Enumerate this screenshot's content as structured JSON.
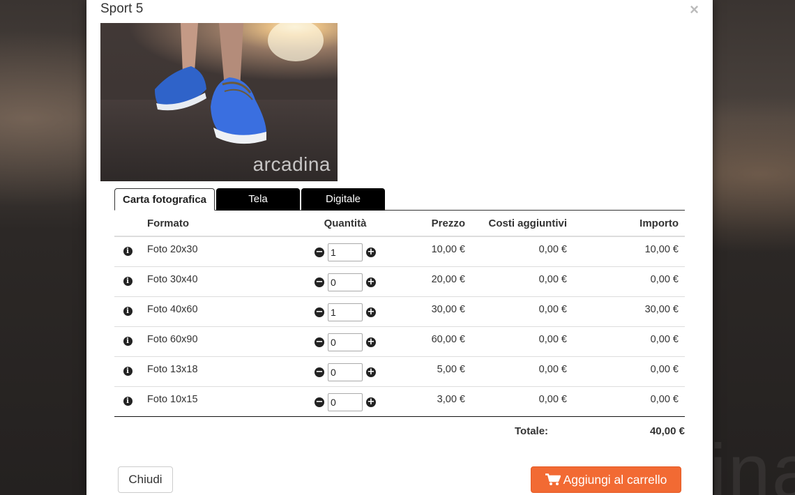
{
  "modal": {
    "title": "Sport 5",
    "close_glyph": "×",
    "photo_watermark": "arcadina"
  },
  "tabs": [
    {
      "label": "Carta fotografica",
      "active": true
    },
    {
      "label": "Tela",
      "active": false
    },
    {
      "label": "Digitale",
      "active": false
    }
  ],
  "table": {
    "headers": {
      "format": "Formato",
      "quantity": "Quantità",
      "price": "Prezzo",
      "extra": "Costi aggiuntivi",
      "amount": "Importo"
    },
    "rows": [
      {
        "format": "Foto 20x30",
        "quantity": "1",
        "price": "10,00 €",
        "extra": "0,00 €",
        "amount": "10,00 €"
      },
      {
        "format": "Foto 30x40",
        "quantity": "0",
        "price": "20,00 €",
        "extra": "0,00 €",
        "amount": "0,00 €"
      },
      {
        "format": "Foto 40x60",
        "quantity": "1",
        "price": "30,00 €",
        "extra": "0,00 €",
        "amount": "30,00 €"
      },
      {
        "format": "Foto 60x90",
        "quantity": "0",
        "price": "60,00 €",
        "extra": "0,00 €",
        "amount": "0,00 €"
      },
      {
        "format": "Foto 13x18",
        "quantity": "0",
        "price": "5,00 €",
        "extra": "0,00 €",
        "amount": "0,00 €"
      },
      {
        "format": "Foto 10x15",
        "quantity": "0",
        "price": "3,00 €",
        "extra": "0,00 €",
        "amount": "0,00 €"
      }
    ]
  },
  "total": {
    "label": "Totale:",
    "value": "40,00 €"
  },
  "buttons": {
    "close_label": "Chiudi",
    "cart_label": "Aggiungi al carrello",
    "cart_icon": "shopping-cart-icon"
  },
  "colors": {
    "accent": "#f26a33",
    "tab_inactive_bg": "#000000"
  }
}
